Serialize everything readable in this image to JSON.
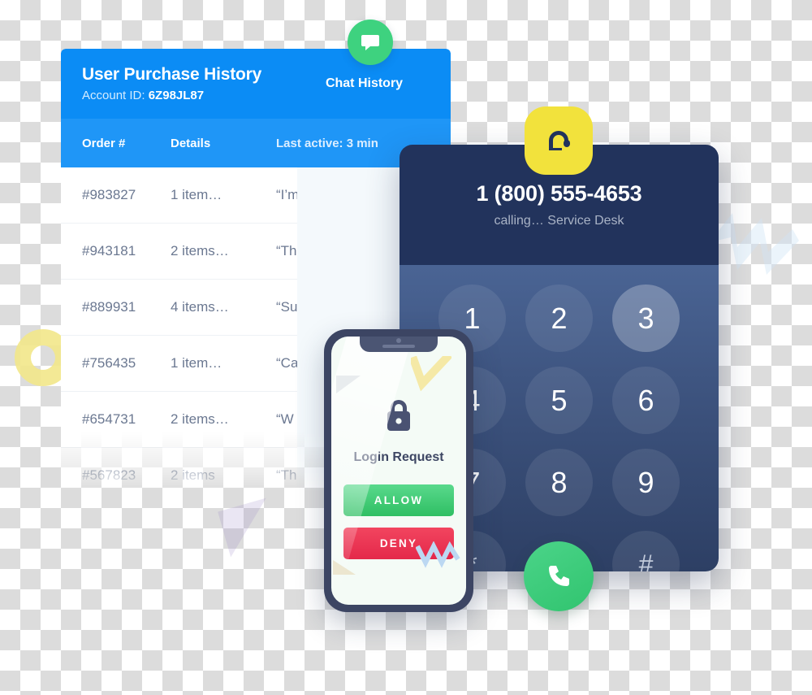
{
  "purchase_card": {
    "title": "User Purchase History",
    "account_label": "Account ID:",
    "account_id": "6Z98JL87",
    "chat_tab_label": "Chat History",
    "chat_badge_icon": "chat-bubble-icon",
    "columns": {
      "order": "Order #",
      "details": "Details",
      "chat": "Last active: 3 min"
    },
    "rows": [
      {
        "order": "#983827",
        "details": "1 item…",
        "chat": "“I’m looking f"
      },
      {
        "order": "#943181",
        "details": "2 items…",
        "chat": "“Thanks! Tha"
      },
      {
        "order": "#889931",
        "details": "4 items…",
        "chat": "“Sure, happy"
      },
      {
        "order": "#756435",
        "details": "1 item…",
        "chat": "“Ca"
      },
      {
        "order": "#654731",
        "details": "2 items…",
        "chat": "“W"
      },
      {
        "order": "#567823",
        "details": "2 items",
        "chat": "“Th"
      }
    ]
  },
  "dialer": {
    "badge_icon": "headset-icon",
    "phone_number": "1 (800) 555-4653",
    "status": "calling… Service Desk",
    "keys": [
      {
        "label": "1",
        "active": false,
        "symbol": false
      },
      {
        "label": "2",
        "active": false,
        "symbol": false
      },
      {
        "label": "3",
        "active": true,
        "symbol": false
      },
      {
        "label": "4",
        "active": false,
        "symbol": false
      },
      {
        "label": "5",
        "active": false,
        "symbol": false
      },
      {
        "label": "6",
        "active": false,
        "symbol": false
      },
      {
        "label": "7",
        "active": false,
        "symbol": false
      },
      {
        "label": "8",
        "active": false,
        "symbol": false
      },
      {
        "label": "9",
        "active": false,
        "symbol": false
      },
      {
        "label": "*",
        "active": false,
        "symbol": true
      },
      {
        "label": "",
        "active": false,
        "symbol": true
      },
      {
        "label": "#",
        "active": false,
        "symbol": true
      }
    ],
    "call_button_icon": "phone-handset-icon"
  },
  "phone_mockup": {
    "lock_icon": "padlock-icon",
    "title": "Login Request",
    "allow_label": "ALLOW",
    "deny_label": "DENY"
  },
  "colors": {
    "brand_blue": "#0b8cf5",
    "table_head_blue": "#1f96f7",
    "navy": "#22335c",
    "dialpad_blue": "#4a6494",
    "green": "#3ed27f",
    "allow_green": "#2fbf63",
    "deny_red": "#e4284a",
    "badge_yellow": "#f2e23c"
  }
}
